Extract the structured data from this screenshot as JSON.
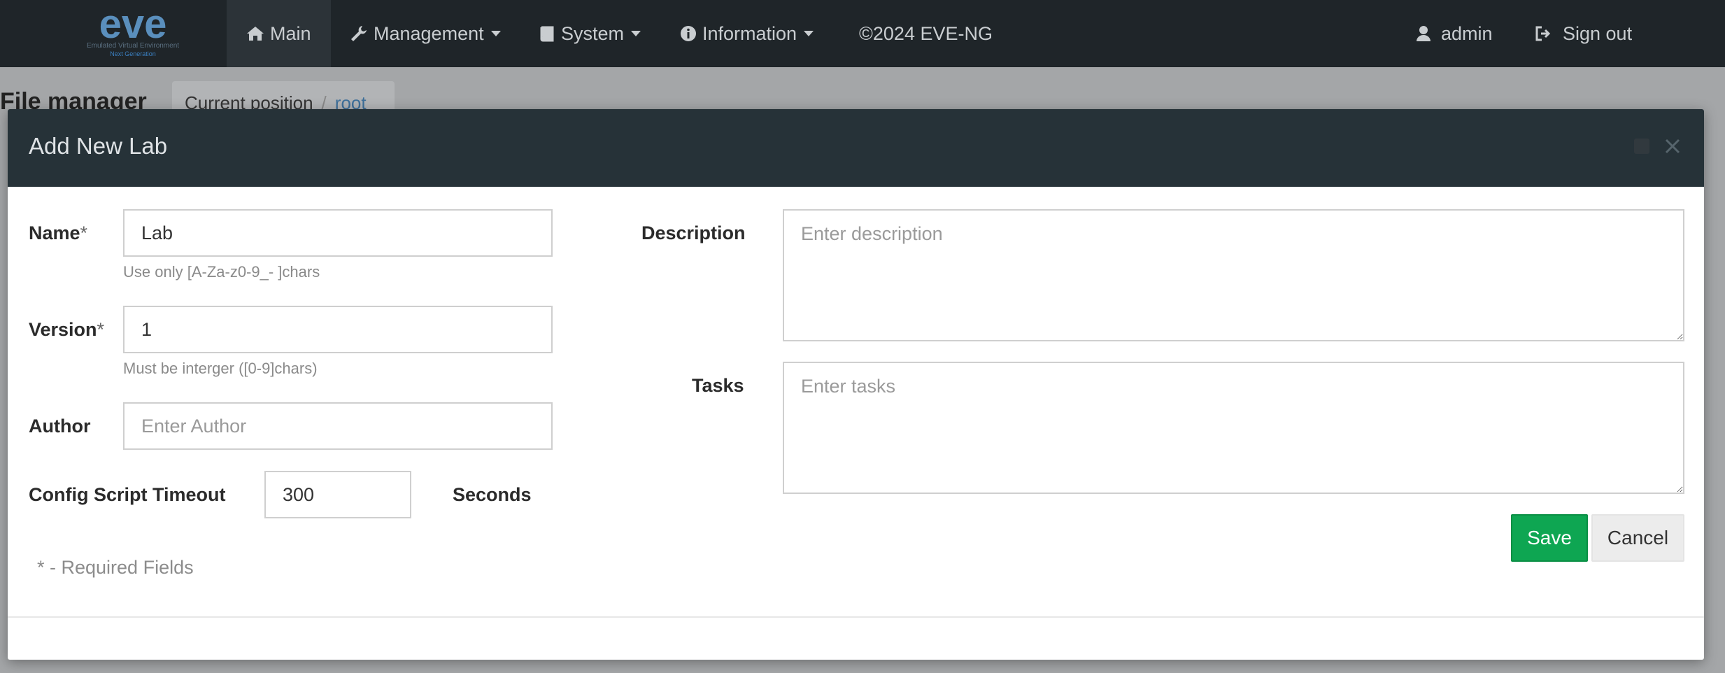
{
  "navbar": {
    "logo_text": "eve",
    "logo_subtext": "Emulated Virtual Environment",
    "logo_subtext2": "Next Generation",
    "items": [
      {
        "label": "Main"
      },
      {
        "label": "Management"
      },
      {
        "label": "System"
      },
      {
        "label": "Information"
      },
      {
        "label": "©2024 EVE-NG"
      }
    ],
    "user": "admin",
    "signout": "Sign out"
  },
  "background": {
    "title": "File manager",
    "breadcrumb_label": "Current position",
    "breadcrumb_link": "root"
  },
  "modal": {
    "title": "Add New Lab",
    "fields": {
      "name_label": "Name",
      "name_value": "Lab",
      "name_help": "Use only [A-Za-z0-9_- ]chars",
      "version_label": "Version",
      "version_value": "1",
      "version_help": "Must be interger ([0-9]chars)",
      "author_label": "Author",
      "author_placeholder": "Enter Author",
      "timeout_label": "Config Script Timeout",
      "timeout_value": "300",
      "timeout_unit": "Seconds",
      "description_label": "Description",
      "description_placeholder": "Enter description",
      "tasks_label": "Tasks",
      "tasks_placeholder": "Enter tasks",
      "required_marker": "*"
    },
    "required_note": "* - Required Fields",
    "save_label": "Save",
    "cancel_label": "Cancel"
  },
  "colors": {
    "navbar_bg": "#1f2529",
    "modal_header_bg": "#263238",
    "save_green": "#0ea652"
  }
}
